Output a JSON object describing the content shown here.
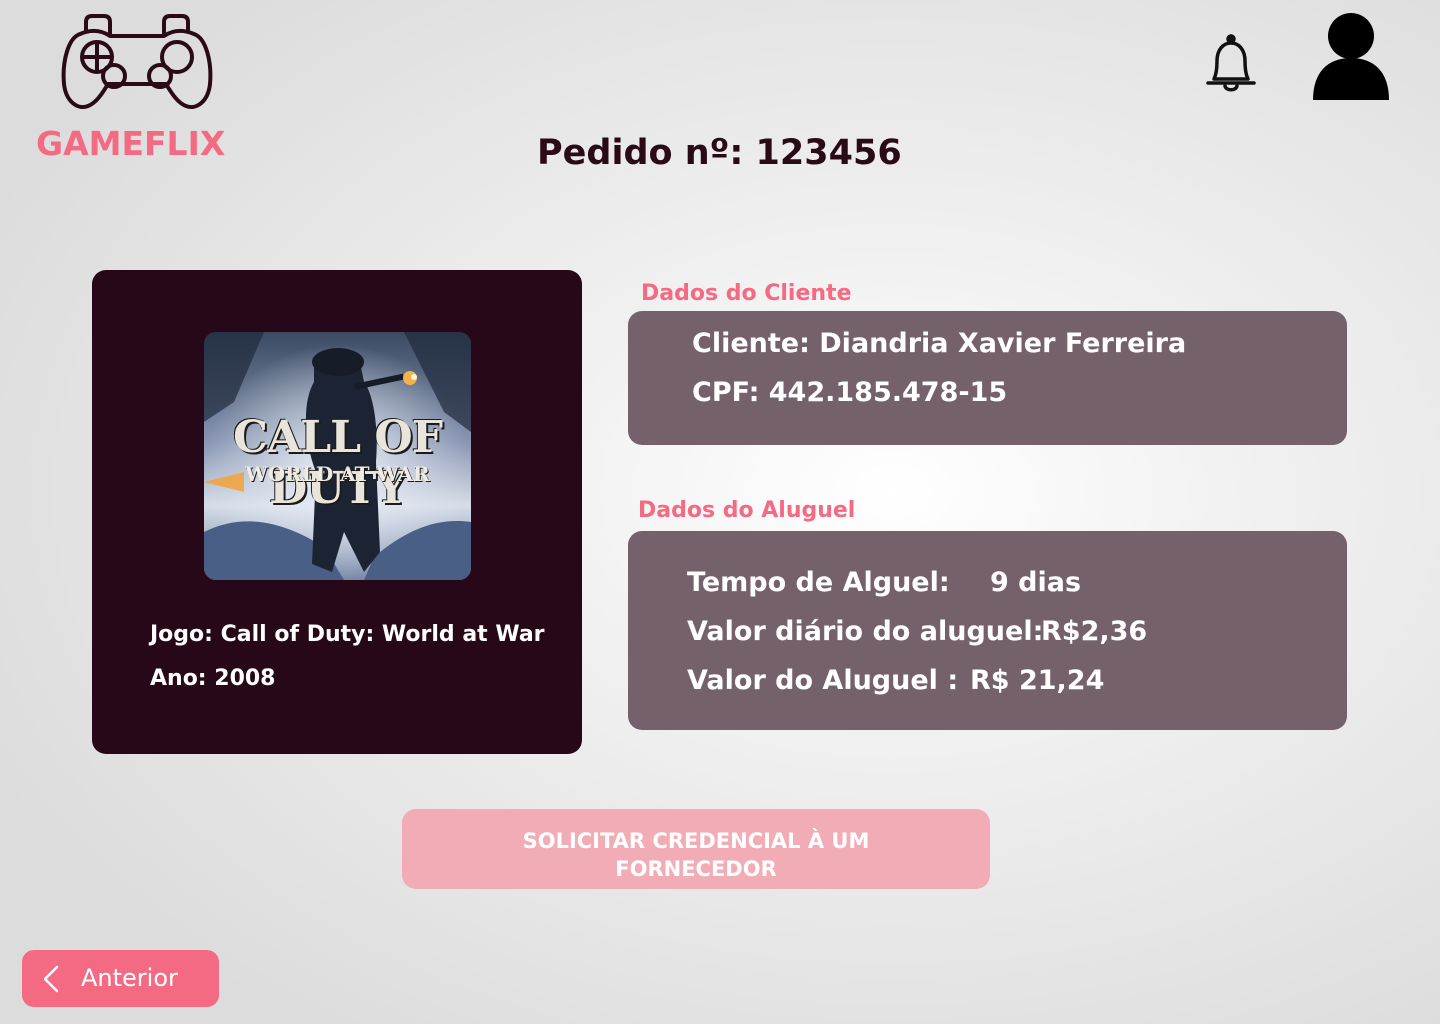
{
  "brand": {
    "name": "GAMEFLIX",
    "color": "#f46a82"
  },
  "header": {
    "notifications_icon": "bell-icon",
    "profile_icon": "user-icon"
  },
  "order": {
    "title": "Pedido nº: 123456"
  },
  "game": {
    "cover_title": "CALL OF DUTY",
    "cover_subtitle": "WORLD AT WAR",
    "name_line": "Jogo: Call of Duty: World at War",
    "year_line": "Ano: 2008"
  },
  "client": {
    "section_label": "Dados do Cliente",
    "name_line": "Cliente: Diandria Xavier Ferreira",
    "cpf_line": "CPF: 442.185.478-15"
  },
  "rental": {
    "section_label": "Dados do Aluguel",
    "period_label": "Tempo de Alguel:",
    "period_value": "9 dias",
    "daily_label": "Valor diário do aluguel:",
    "daily_value": "R$2,36",
    "total_label": "Valor do Aluguel :",
    "total_value": "R$ 21,24"
  },
  "actions": {
    "request_line1": "SOLICITAR CREDENCIAL À UM",
    "request_line2": "FORNECEDOR",
    "back_label": "Anterior"
  },
  "colors": {
    "dark": "#260818",
    "panel": "#75616b",
    "accent": "#f46a82",
    "button": "#f2acb5"
  }
}
